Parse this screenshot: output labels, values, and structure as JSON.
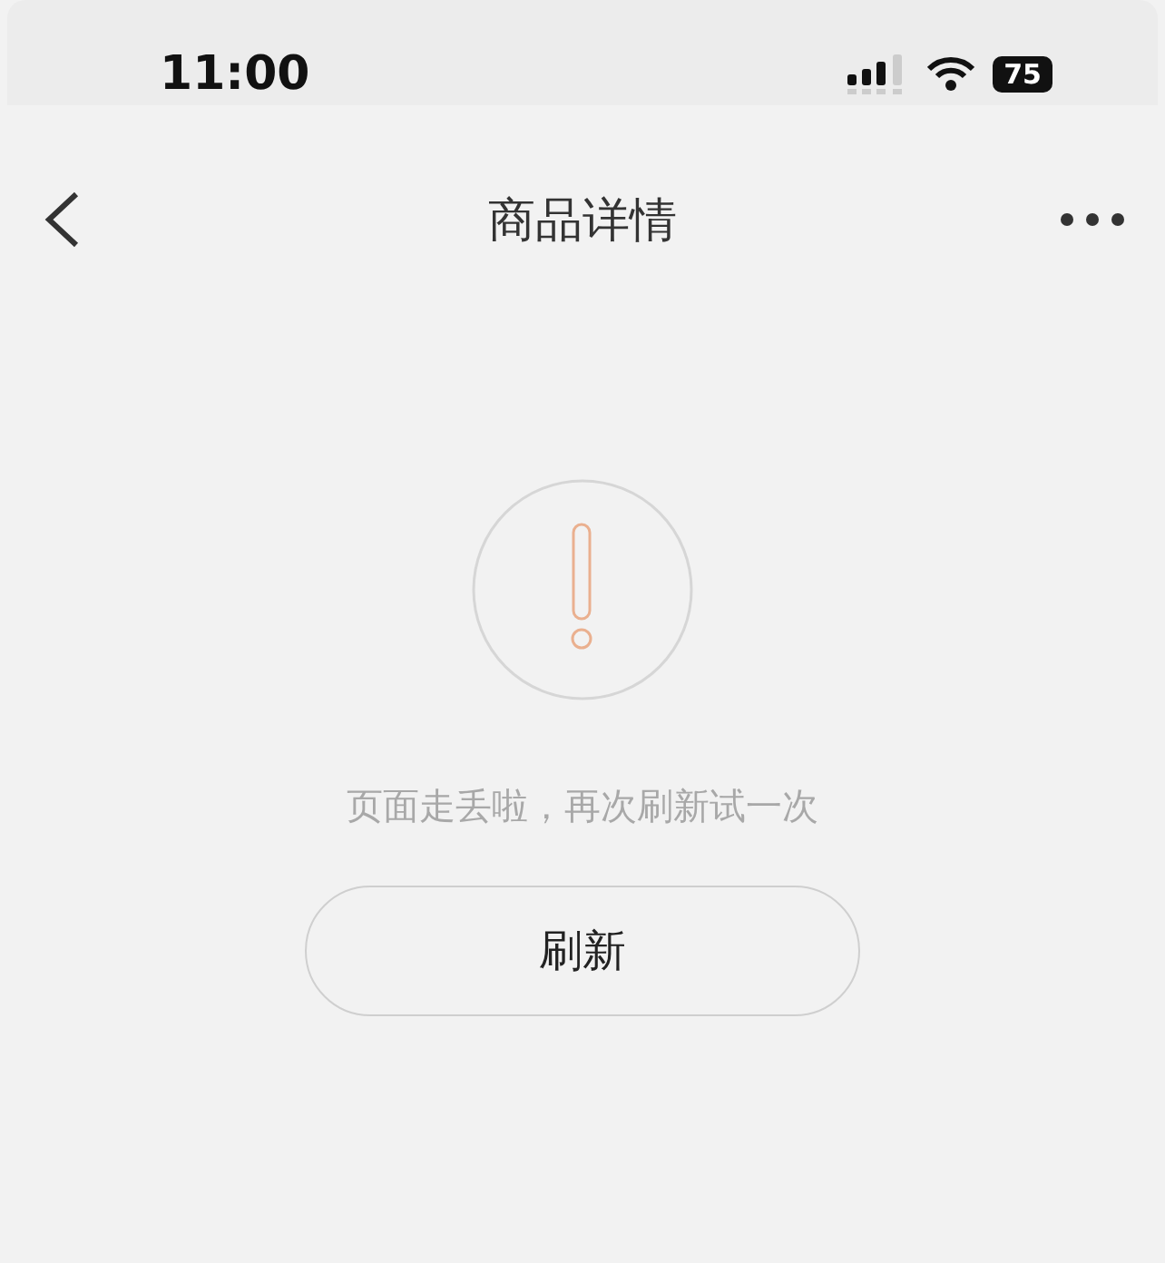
{
  "status_bar": {
    "time": "11:00",
    "battery": "75"
  },
  "nav_bar": {
    "title": "商品详情"
  },
  "error_state": {
    "message": "页面走丢啦，再次刷新试一次",
    "button": "刷新"
  }
}
